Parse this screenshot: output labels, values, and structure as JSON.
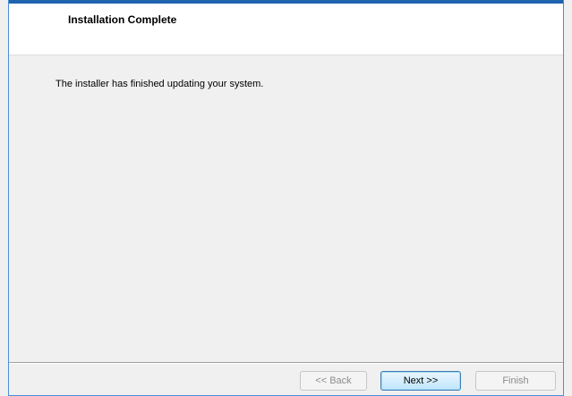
{
  "header": {
    "title": "Installation Complete"
  },
  "content": {
    "message": "The installer has finished updating your system."
  },
  "buttons": {
    "back_label": "<< Back",
    "next_label": "Next >>",
    "finish_label": "Finish",
    "back_enabled": false,
    "next_enabled": true,
    "finish_enabled": false
  },
  "colors": {
    "accent_bar": "#1f62b0",
    "header_bg": "#ffffff",
    "body_bg": "#f0f0f0",
    "disabled_text": "#8c8c8c"
  }
}
